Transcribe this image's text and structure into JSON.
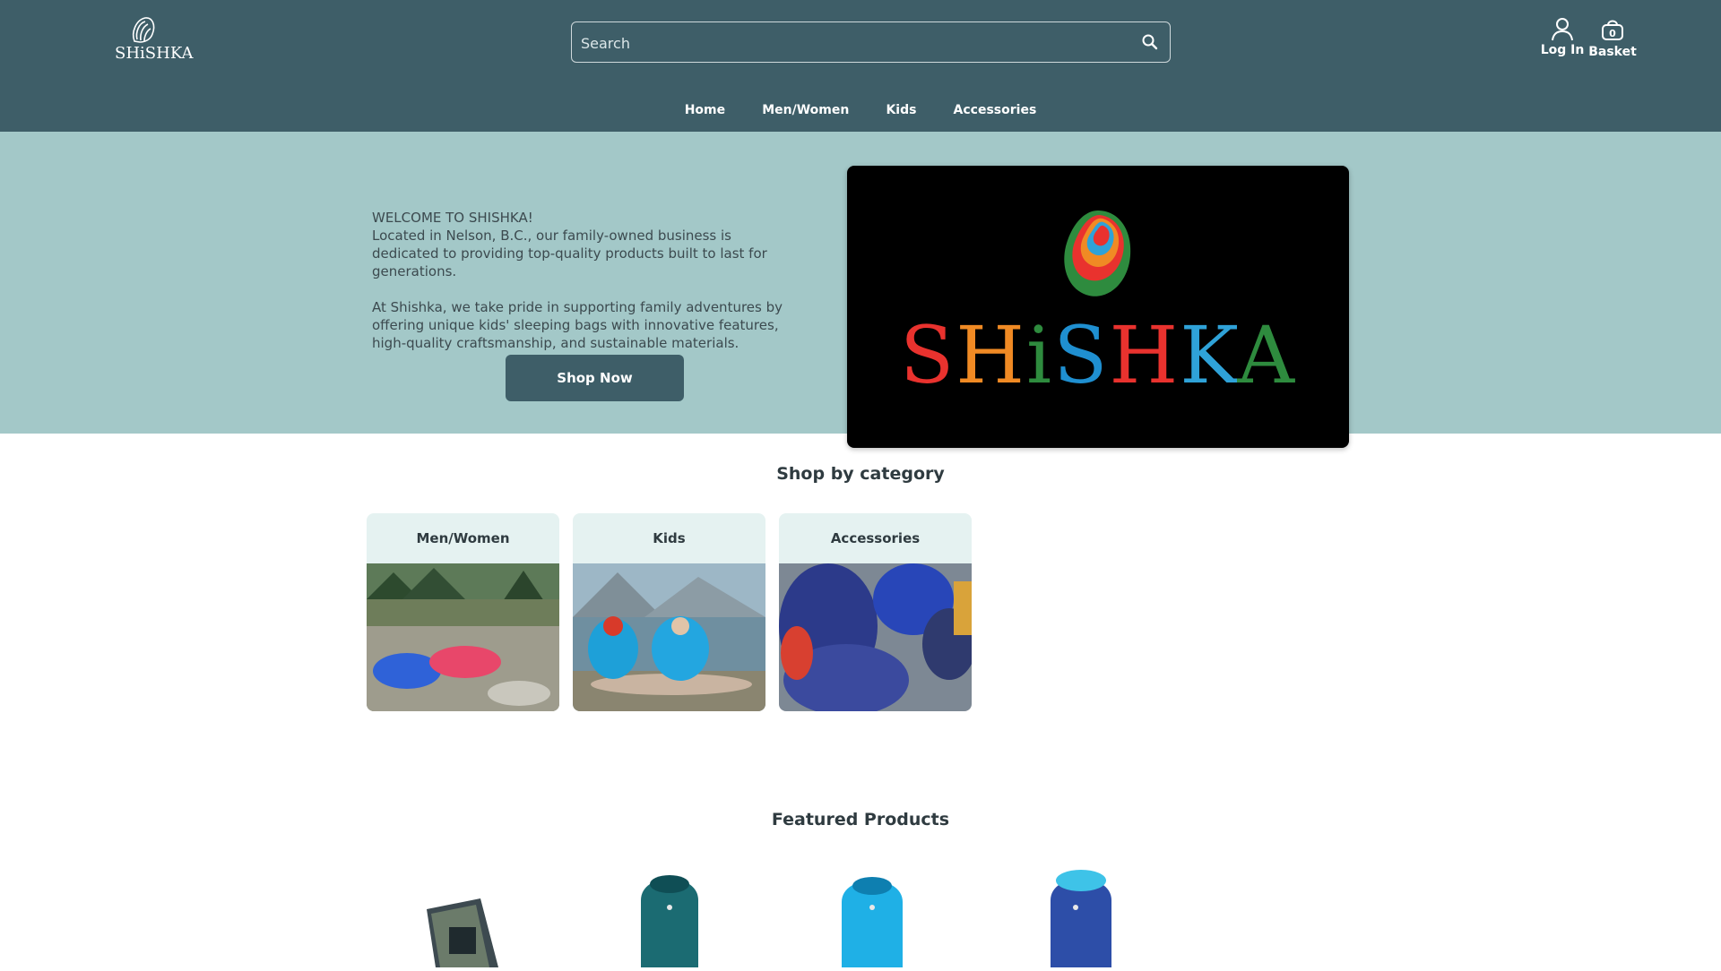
{
  "header": {
    "logo_text": "SHiSHKA",
    "search": {
      "placeholder": "Search",
      "value": ""
    },
    "login_label": "Log In",
    "basket_label": "Basket",
    "basket_count": "0",
    "nav": [
      "Home",
      "Men/Women",
      "Kids",
      "Accessories"
    ]
  },
  "hero": {
    "heading": "WELCOME TO SHISHKA!",
    "paragraph1": "Located in Nelson, B.C., our family-owned business is dedicated  to providing top-quality products built to last for generations.",
    "paragraph2": "At Shishka, we take pride in supporting family adventures by offering unique kids' sleeping bags with innovative features, high-quality craftsmanship, and sustainable materials.",
    "cta_label": "Shop Now",
    "banner_brand": "SHiSHKA"
  },
  "categories": {
    "title": "Shop by category",
    "items": [
      {
        "label": "Men/Women"
      },
      {
        "label": "Kids"
      },
      {
        "label": "Accessories"
      }
    ]
  },
  "featured": {
    "title": "Featured Products"
  },
  "colors": {
    "header_bg": "#3e5e68",
    "hero_bg": "#a3c8c8",
    "category_label_bg": "#e5f2f1",
    "button_bg": "#3e5e68"
  },
  "icons": [
    "search-icon",
    "user-icon",
    "basket-icon",
    "shell-logo-icon"
  ]
}
